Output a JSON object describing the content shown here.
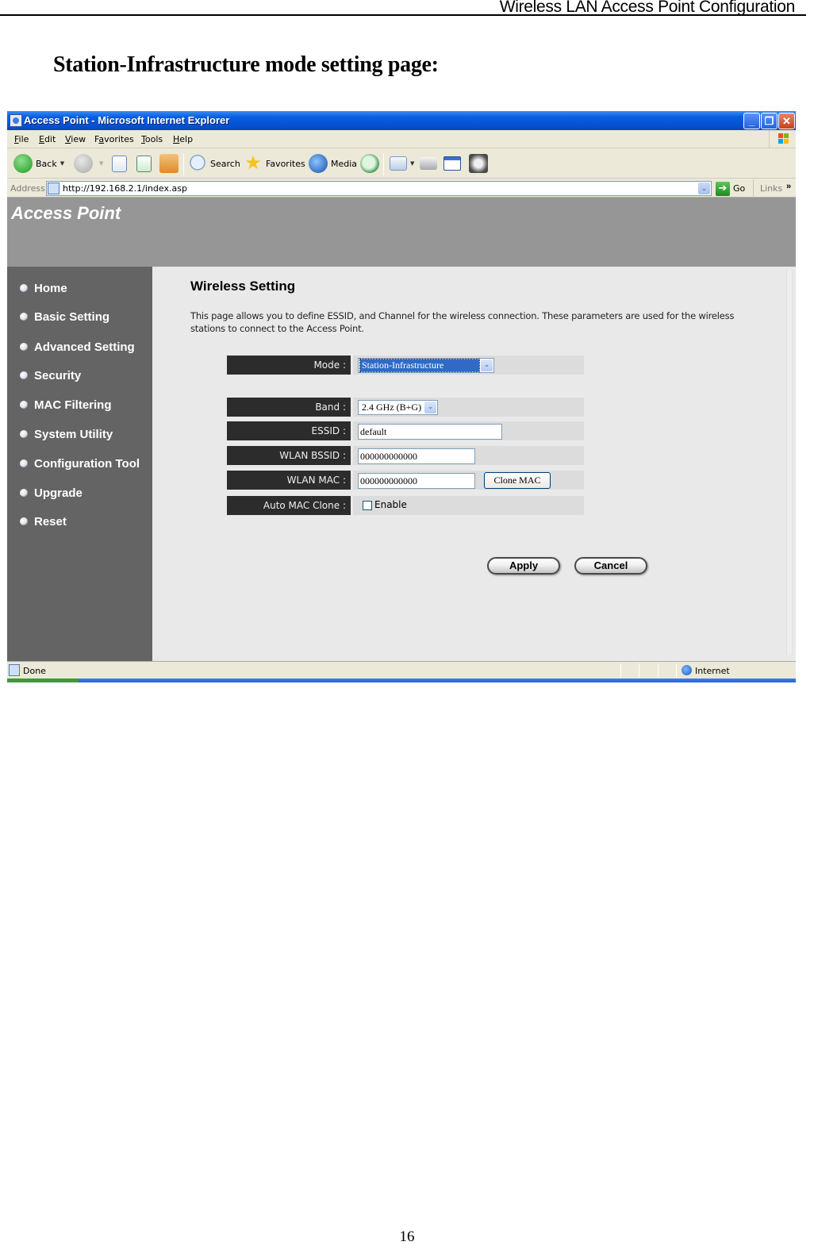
{
  "document": {
    "header_title": "Wireless LAN Access Point Configuration",
    "heading": "Station-Infrastructure mode setting page:",
    "page_number": "16"
  },
  "browser": {
    "window_title": "Access Point - Microsoft Internet Explorer",
    "window_buttons": {
      "minimize": "_",
      "maximize": "❐",
      "close": "✕"
    },
    "menu": [
      {
        "label": "File",
        "accel": "F",
        "rest": "ile"
      },
      {
        "label": "Edit",
        "accel": "E",
        "rest": "dit"
      },
      {
        "label": "View",
        "accel": "V",
        "rest": "iew"
      },
      {
        "label": "Favorites",
        "accel": "a",
        "pre": "F",
        "rest": "vorites"
      },
      {
        "label": "Tools",
        "accel": "T",
        "rest": "ools"
      },
      {
        "label": "Help",
        "accel": "H",
        "rest": "elp"
      }
    ],
    "toolbar": {
      "back": "Back",
      "search": "Search",
      "favorites": "Favorites",
      "media": "Media",
      "dropdown_glyph": "▼",
      "icons": [
        "back-icon",
        "forward-icon",
        "stop-icon",
        "refresh-icon",
        "home-icon",
        "search-icon",
        "favorites-star-icon",
        "media-icon",
        "history-icon",
        "mail-icon",
        "print-icon",
        "edit-icon",
        "messenger-icon"
      ]
    },
    "address": {
      "label": "Address",
      "url": "http://192.168.2.1/index.asp",
      "dropdown_glyph": "⌄",
      "go_label": "Go",
      "go_glyph": "➔",
      "links_label": "Links",
      "links_chevron": "»"
    },
    "status": {
      "text": "Done",
      "zone": "Internet"
    }
  },
  "page": {
    "banner_title": "Access Point",
    "nav": [
      {
        "label": "Home"
      },
      {
        "label": "Basic Setting"
      },
      {
        "label": "Advanced Setting"
      },
      {
        "label": "Security"
      },
      {
        "label": "MAC Filtering"
      },
      {
        "label": "System Utility"
      },
      {
        "label": "Configuration Tool"
      },
      {
        "label": "Upgrade"
      },
      {
        "label": "Reset"
      }
    ],
    "section_title": "Wireless Setting",
    "section_desc": "This page allows you to define ESSID, and Channel for the wireless connection. These parameters are used for the wireless stations to connect to the Access Point.",
    "form": {
      "mode": {
        "label": "Mode :",
        "value": "Station-Infrastructure"
      },
      "band": {
        "label": "Band :",
        "value": "2.4 GHz (B+G)"
      },
      "essid": {
        "label": "ESSID :",
        "value": "default"
      },
      "bssid": {
        "label": "WLAN BSSID :",
        "value": "000000000000"
      },
      "mac": {
        "label": "WLAN MAC :",
        "value": "000000000000",
        "clone_button": "Clone MAC"
      },
      "auto_clone": {
        "label": "Auto MAC Clone :",
        "checkbox_label": "Enable",
        "checked": false
      },
      "select_arrow": "⌄"
    },
    "buttons": {
      "apply": "Apply",
      "cancel": "Cancel"
    }
  },
  "colors": {
    "titlebar": "#0553d6",
    "chrome": "#ece9d8",
    "banner": "#969696",
    "sidebar": "#646464",
    "content_bg": "#e9e9e9",
    "form_label_bg": "#2c2c2c",
    "form_cell_bg": "#dcdcdc",
    "selection": "#316ac5"
  }
}
